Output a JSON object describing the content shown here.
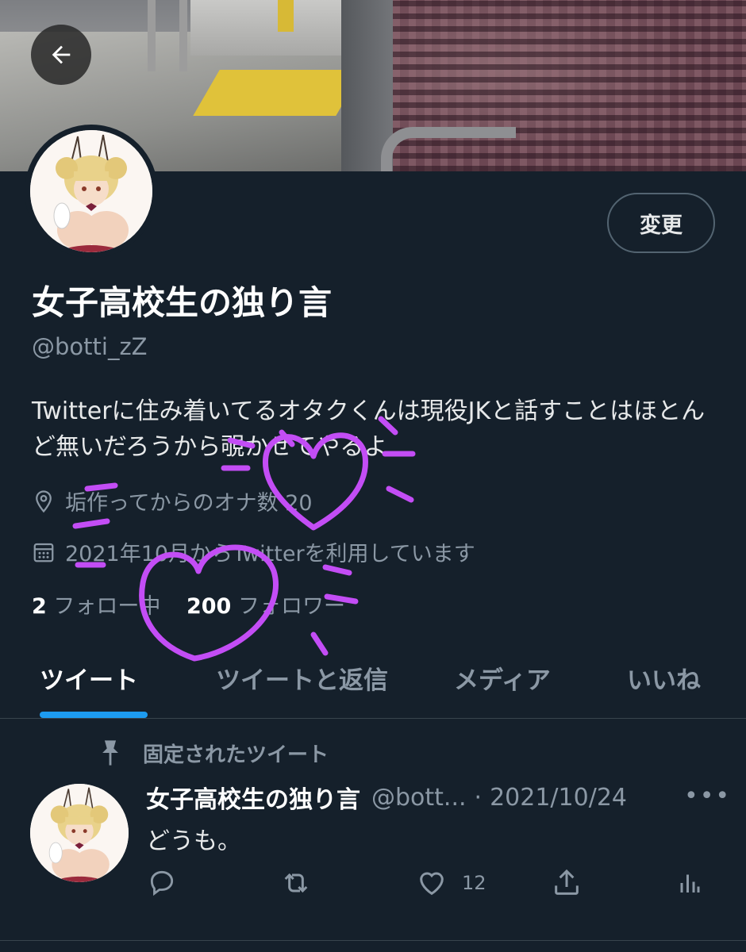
{
  "profile": {
    "display_name": "女子高校生の独り言",
    "handle": "@botti_zZ",
    "bio": "Twitterに住み着いてるオタクくんは現役JKと話すことはほとんど無いだろうから覗かせてやるよ",
    "location": "垢作ってからのオナ数 20",
    "joined": "2021年10月からTwitterを利用しています",
    "following_count": "2",
    "following_label": "フォロー中",
    "followers_count": "200",
    "followers_label": "フォロワー"
  },
  "header": {
    "edit_button": "変更"
  },
  "tabs": [
    {
      "label": "ツイート",
      "active": true
    },
    {
      "label": "ツイートと返信",
      "active": false
    },
    {
      "label": "メディア",
      "active": false
    },
    {
      "label": "いいね",
      "active": false
    }
  ],
  "pinned_tweet": {
    "pinned_label": "固定されたツイート",
    "author_name": "女子高校生の独り言",
    "author_handle": "@bott...",
    "separator": "·",
    "date": "2021/10/24",
    "text": "どうも。",
    "like_count": "12"
  },
  "icons": {
    "back": "arrow-left-icon",
    "location": "location-pin-icon",
    "calendar": "calendar-icon",
    "pin": "pin-icon",
    "more": "more-dots-icon",
    "reply": "reply-icon",
    "retweet": "retweet-icon",
    "like": "heart-icon",
    "share": "share-icon",
    "analytics": "analytics-icon"
  },
  "colors": {
    "background": "#15202b",
    "accent": "#1d9bf0",
    "secondary_text": "#8b98a5",
    "annotation": "#c34df5"
  }
}
